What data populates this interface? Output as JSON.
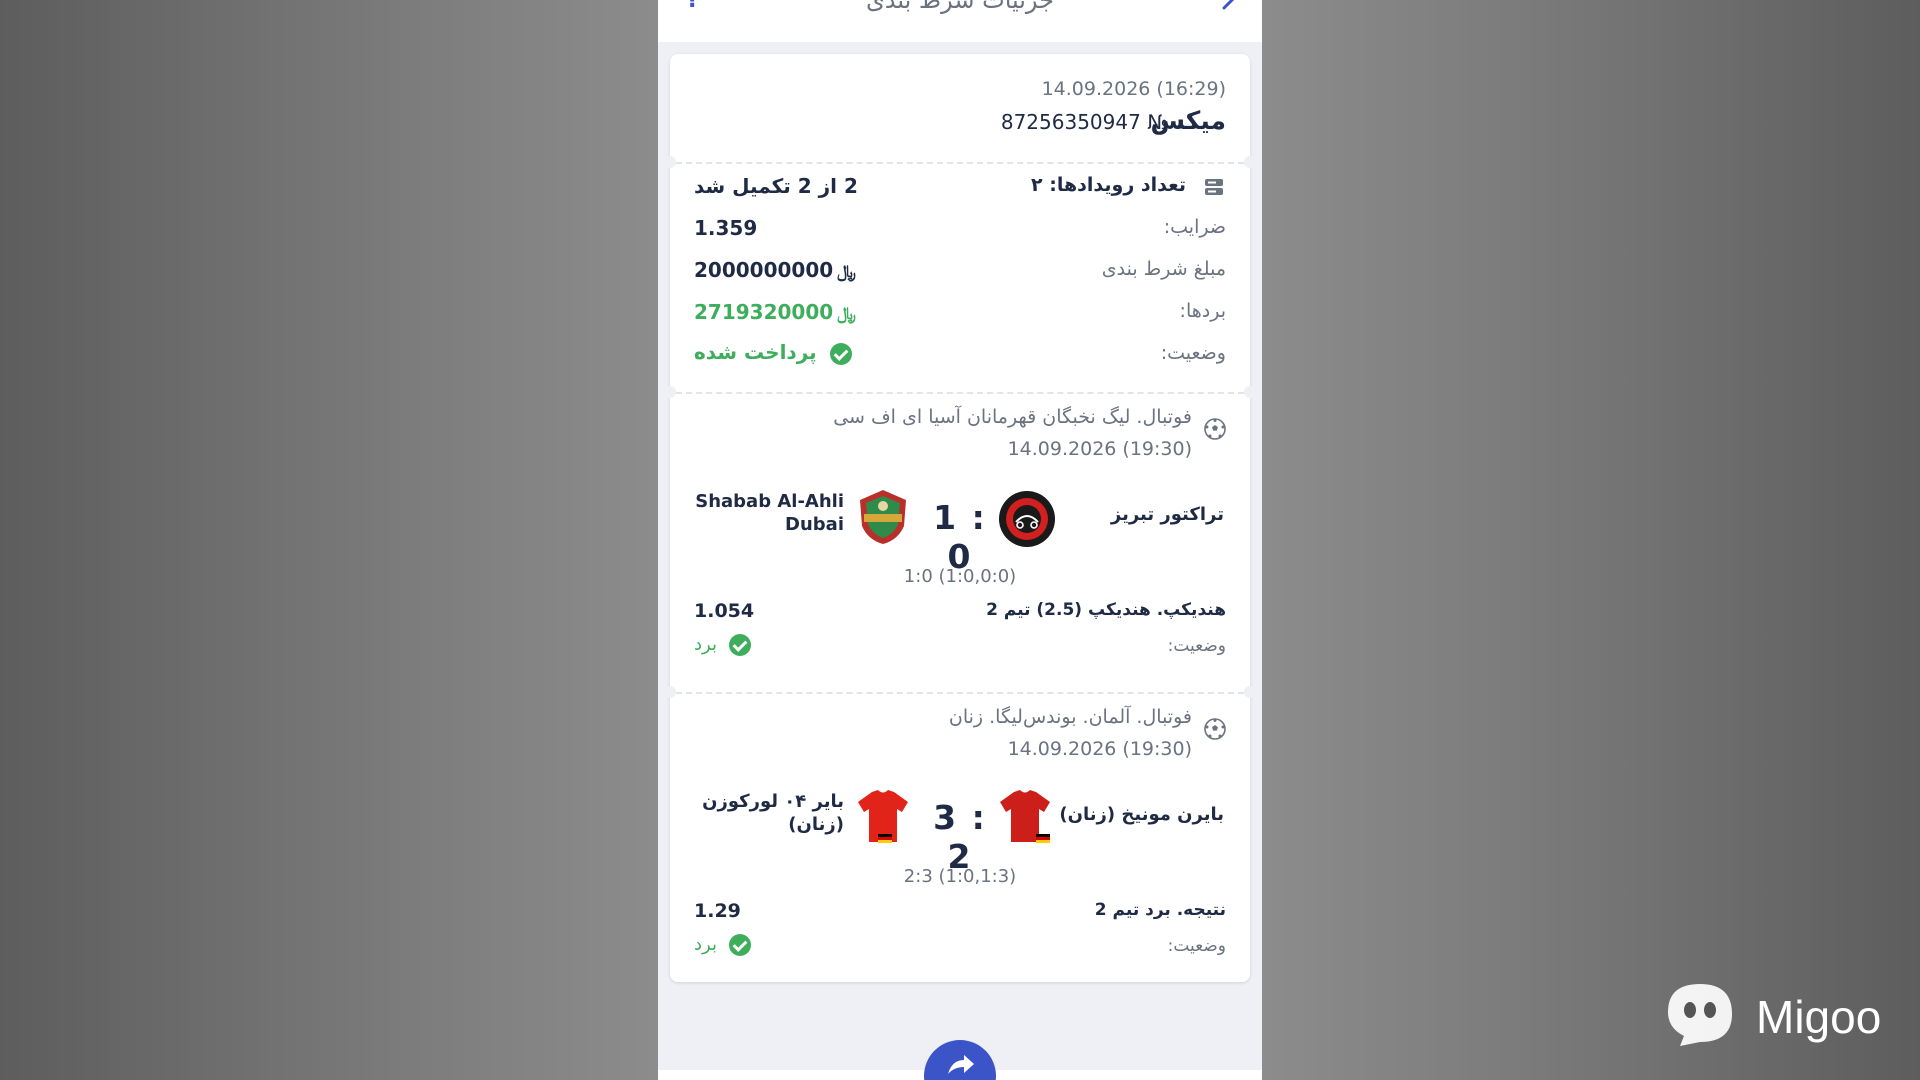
{
  "header": {
    "title": "جزئیات شرط بندی"
  },
  "ticket": {
    "date": "14.09.2026 (16:29)",
    "type": "میکس",
    "number": "87256350947 №",
    "events_label": "تعداد رویدادها: ۲",
    "completed": "2 از 2 تکمیل شد",
    "odds_label": "ضرایب:",
    "odds_value": "1.359",
    "stake_label": "مبلغ شرط بندی",
    "stake_value": "2000000000",
    "winnings_label": "بردها:",
    "winnings_value": "2719320000",
    "currency": "﷼",
    "status_label": "وضعیت:",
    "status_value": "پرداخت شده"
  },
  "events": [
    {
      "league": "فوتبال. لیگ نخبگان قهرمانان آسیا ای اف سی",
      "date": "14.09.2026 (19:30)",
      "home_team": "تراکتور تبریز",
      "away_team": "Shabab Al-Ahli Dubai",
      "score": "1 : 0",
      "halftime": "1:0 (1:0,0:0)",
      "market": "هندیکپ. هندیکپ (2.5) تیم 2",
      "odd": "1.054",
      "status_label": "وضعیت:",
      "status_value": "برد",
      "home_logo": "tractor-fc-logo",
      "away_logo": "shabab-al-ahli-logo"
    },
    {
      "league": "فوتبال. آلمان. بوندس‌لیگا. زنان",
      "date": "14.09.2026 (19:30)",
      "home_team": "بایرن مونیخ (زنان)",
      "away_team": "بایر ۰۴ لورکوزن (زنان)",
      "score": "3 : 2",
      "halftime": "2:3 (1:0,1:3)",
      "market": "نتیجه. برد تیم 2",
      "odd": "1.29",
      "status_label": "وضعیت:",
      "status_value": "برد",
      "home_logo": "red-jersey-icon",
      "away_logo": "red-jersey-icon"
    }
  ],
  "watermark": {
    "text": "Migoo"
  },
  "colors": {
    "accent": "#3b55c9",
    "win": "#3fae5c",
    "text_dark": "#1f2a44",
    "text_gray": "#6b7280"
  }
}
